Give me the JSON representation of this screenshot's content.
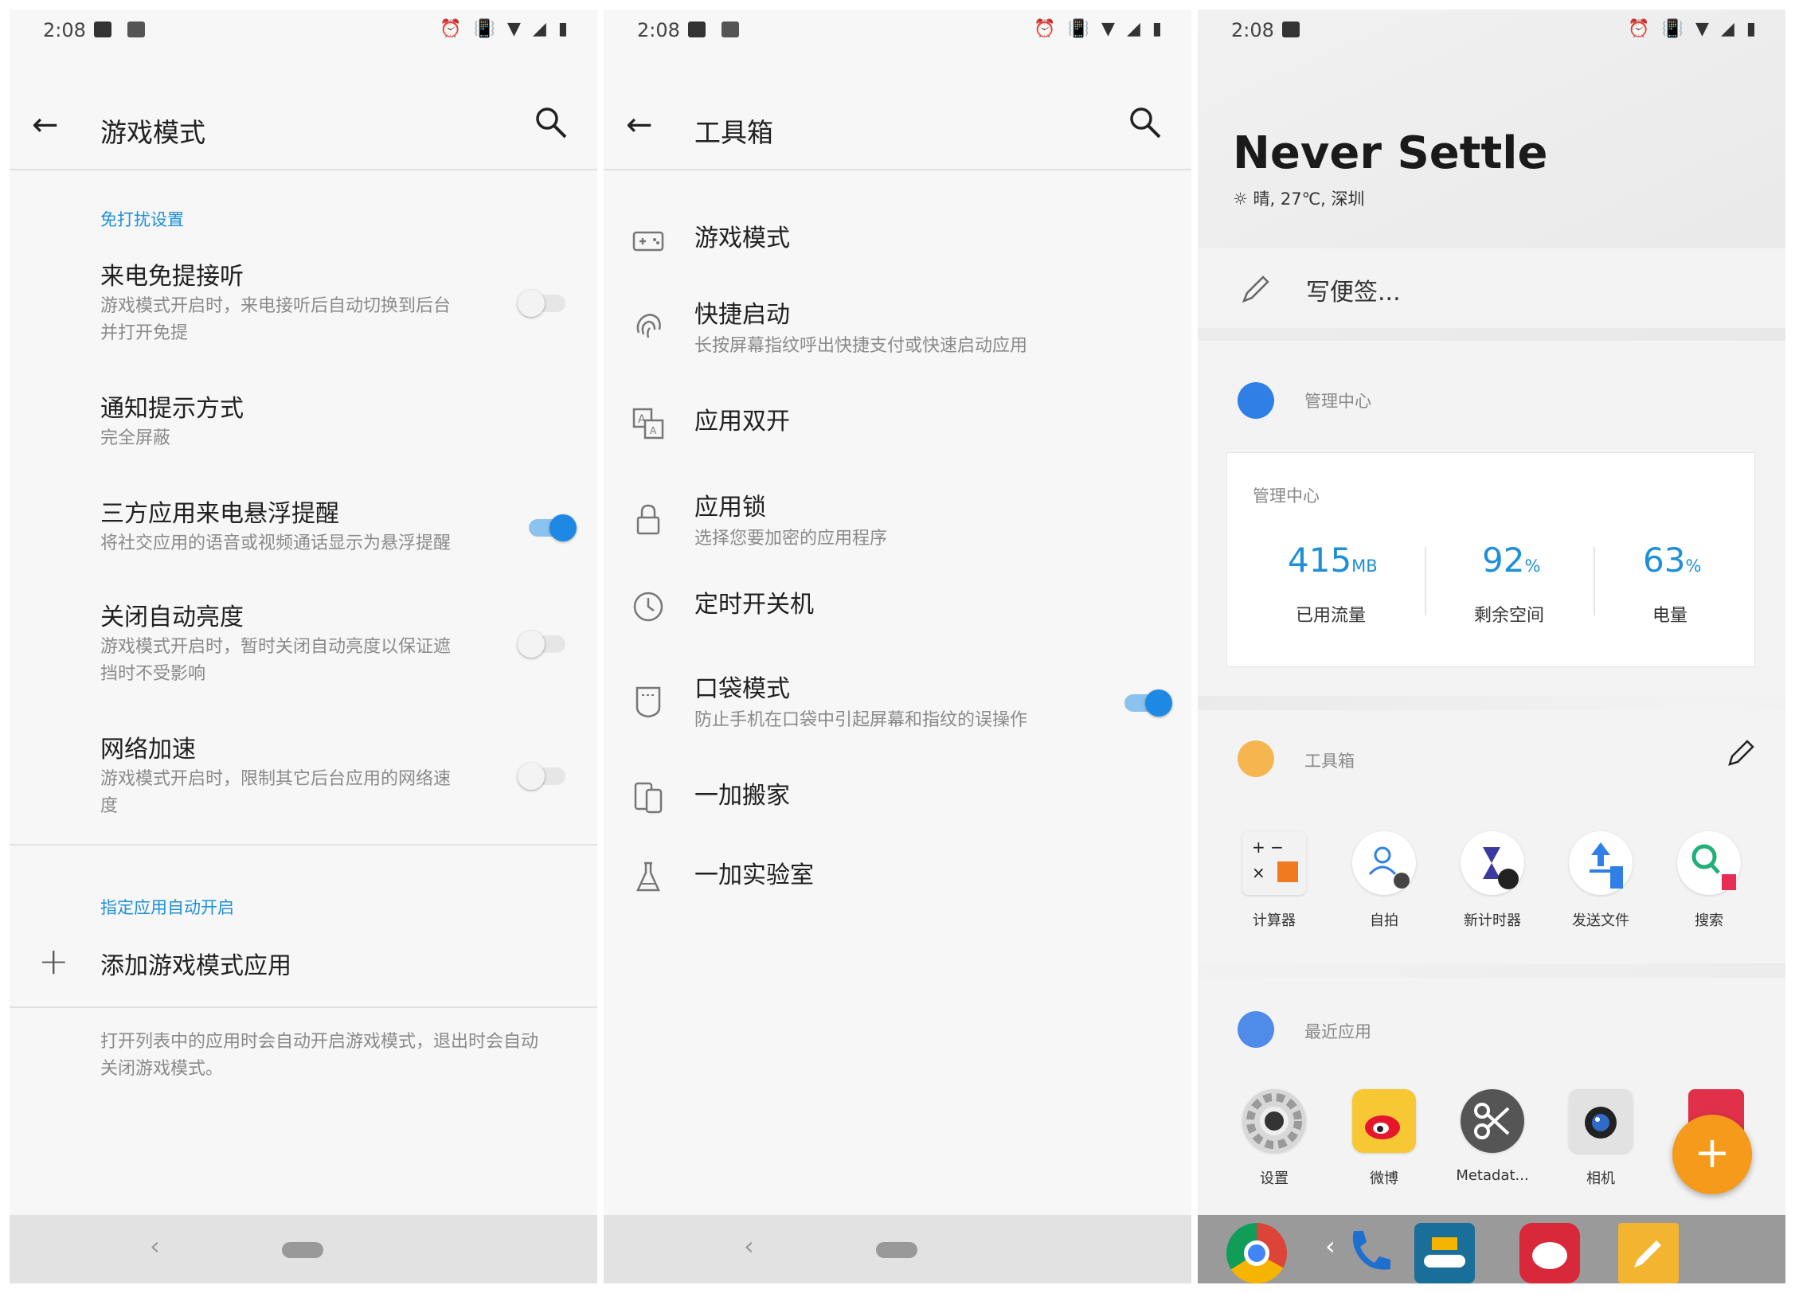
{
  "status_bar": {
    "time": "2:08"
  },
  "game_mode": {
    "title": "游戏模式",
    "section_dnd": "免打扰设置",
    "items": [
      {
        "title": "来电免提接听",
        "sub": "游戏模式开启时，来电接听后自动切换到后台",
        "sub2": "并打开免提",
        "on": false
      },
      {
        "title": "通知提示方式",
        "sub": "完全屏蔽"
      },
      {
        "title": "三方应用来电悬浮提醒",
        "sub": "将社交应用的语音或视频通话显示为悬浮提醒",
        "on": true
      },
      {
        "title": "关闭自动亮度",
        "sub": "游戏模式开启时，暂时关闭自动亮度以保证遮",
        "sub2": "挡时不受影响",
        "on": false
      },
      {
        "title": "网络加速",
        "sub": "游戏模式开启时，限制其它后台应用的网络速",
        "sub2": "度",
        "on": false
      }
    ],
    "section_apps": "指定应用自动开启",
    "add_label": "添加游戏模式应用",
    "footer1": "打开列表中的应用时会自动开启游戏模式，退出时会自动",
    "footer2": "关闭游戏模式。"
  },
  "toolbox": {
    "title": "工具箱",
    "items": [
      {
        "title": "游戏模式",
        "icon": "gamepad-icon"
      },
      {
        "title": "快捷启动",
        "sub": "长按屏幕指纹呼出快捷支付或快速启动应用",
        "icon": "fingerprint-icon"
      },
      {
        "title": "应用双开",
        "icon": "translate-icon"
      },
      {
        "title": "应用锁",
        "sub": "选择您要加密的应用程序",
        "icon": "lock-icon"
      },
      {
        "title": "定时开关机",
        "icon": "clock-icon"
      },
      {
        "title": "口袋模式",
        "sub": "防止手机在口袋中引起屏幕和指纹的误操作",
        "icon": "pocket-icon",
        "on": true
      },
      {
        "title": "一加搬家",
        "icon": "phone-switch-icon"
      },
      {
        "title": "一加实验室",
        "icon": "flask-icon"
      }
    ]
  },
  "shelf": {
    "hero": "Never Settle",
    "weather": "晴, 27℃, 深圳",
    "note_placeholder": "写便签...",
    "mgmt_header": "管理中心",
    "mgmt_card_title": "管理中心",
    "stats": [
      {
        "value": "415",
        "unit": "MB",
        "label": "已用流量"
      },
      {
        "value": "92",
        "unit": "%",
        "label": "剩余空间"
      },
      {
        "value": "63",
        "unit": "%",
        "label": "电量"
      }
    ],
    "toolbox_header": "工具箱",
    "tools": [
      "计算器",
      "自拍",
      "新计时器",
      "发送文件",
      "搜索"
    ],
    "recent_header": "最近应用",
    "recent": [
      "设置",
      "微博",
      "Metadat...",
      "相机"
    ],
    "accent": "#1e8fd8",
    "fab_color": "#f59a1a"
  }
}
